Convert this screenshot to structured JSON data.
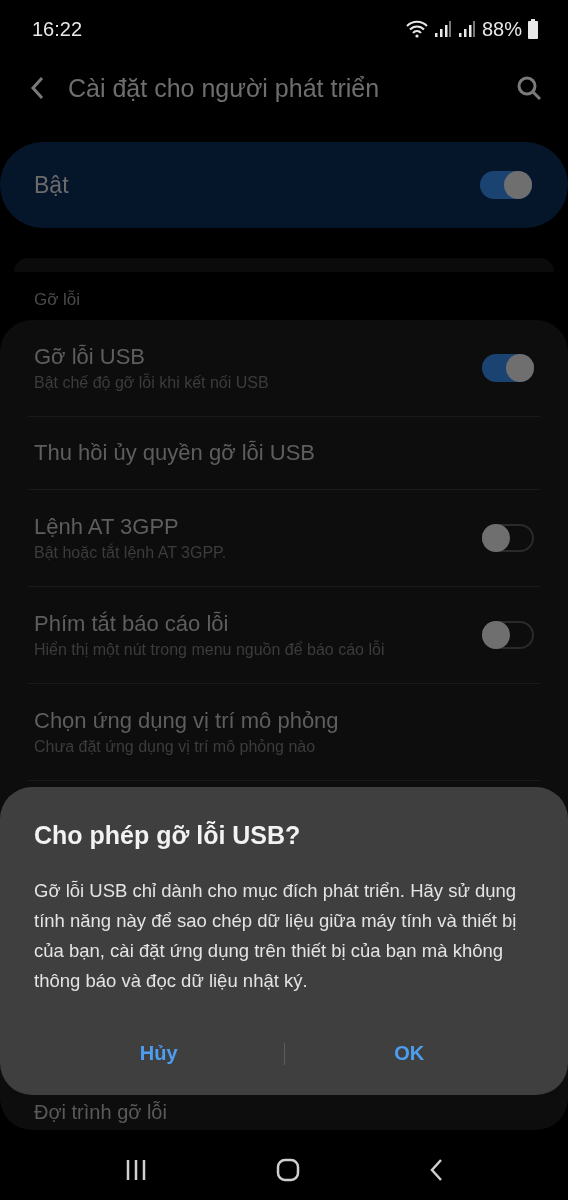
{
  "status_bar": {
    "time": "16:22",
    "battery": "88%"
  },
  "header": {
    "title": "Cài đặt cho người phát triển"
  },
  "master": {
    "label": "Bật",
    "on": true
  },
  "section": {
    "title": "Gỡ lỗi"
  },
  "rows": [
    {
      "kind": "toggle",
      "title": "Gỡ lỗi USB",
      "subtitle": "Bật chế độ gỡ lỗi khi kết nối USB",
      "on": true
    },
    {
      "kind": "plain",
      "title": "Thu hồi ủy quyền gỡ lỗi USB"
    },
    {
      "kind": "toggle",
      "title": "Lệnh AT 3GPP",
      "subtitle": "Bật hoặc tắt lệnh AT 3GPP.",
      "on": false
    },
    {
      "kind": "toggle",
      "title": "Phím tắt báo cáo lỗi",
      "subtitle": "Hiển thị một nút trong menu nguồn để báo cáo lỗi",
      "on": false
    },
    {
      "kind": "plain",
      "title": "Chọn ứng dụng vị trí mô phỏng",
      "subtitle": "Chưa đặt ứng dụng vị trí mô phỏng nào"
    }
  ],
  "bottom_row": {
    "title": "Đợi trình gỡ lỗi"
  },
  "dialog": {
    "title": "Cho phép gỡ lỗi USB?",
    "message": "Gỡ lỗi USB chỉ dành cho mục đích phát triển. Hãy sử dụng tính năng này để sao chép dữ liệu giữa máy tính và thiết bị của bạn, cài đặt ứng dụng trên thiết bị của bạn mà không thông báo và đọc dữ liệu nhật ký.",
    "buttons": [
      "Hủy",
      "OK"
    ]
  }
}
